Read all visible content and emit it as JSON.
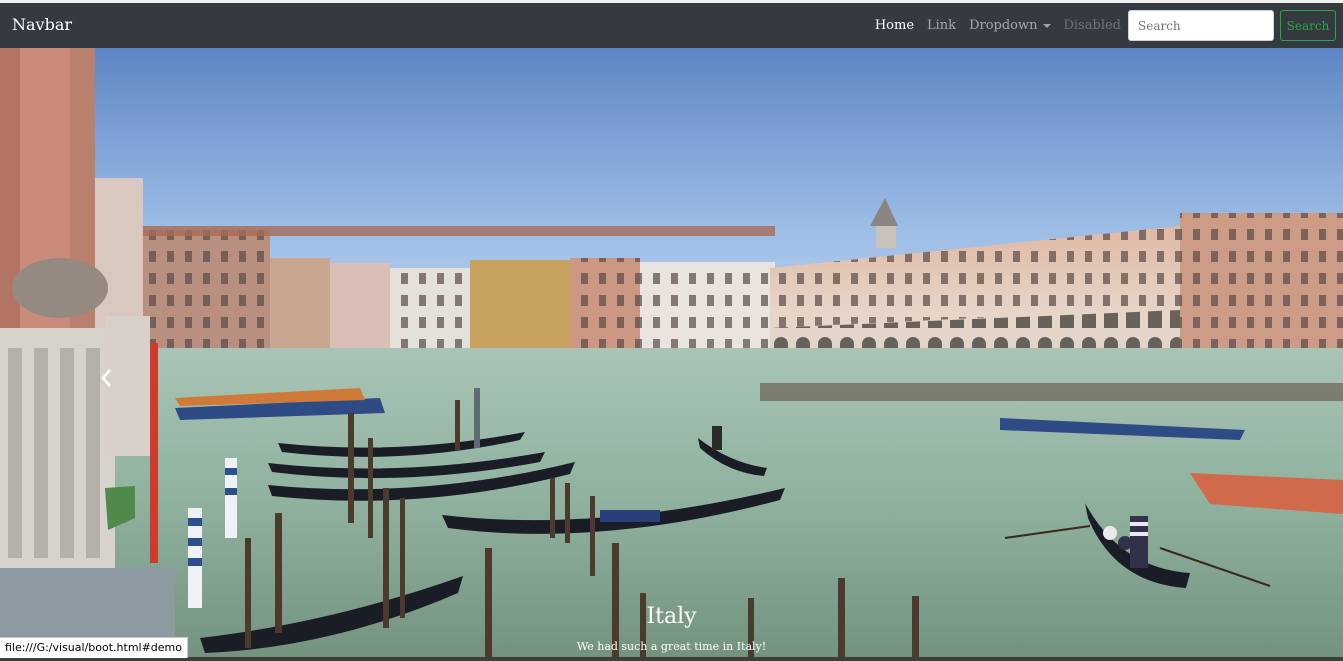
{
  "navbar": {
    "brand": "Navbar",
    "items": [
      {
        "label": "Home"
      },
      {
        "label": "Link"
      },
      {
        "label": "Dropdown"
      },
      {
        "label": "Disabled"
      }
    ],
    "search": {
      "placeholder": "Search",
      "button_label": "Search"
    },
    "colors": {
      "background": "#343a40",
      "success": "#28a745"
    }
  },
  "carousel": {
    "caption_title": "Italy",
    "caption_text": "We had such a great time in Italy!",
    "prev_icon": "chevron-left-icon"
  },
  "status_bar": {
    "url": "file:///G:/visual/boot.html#demo"
  }
}
